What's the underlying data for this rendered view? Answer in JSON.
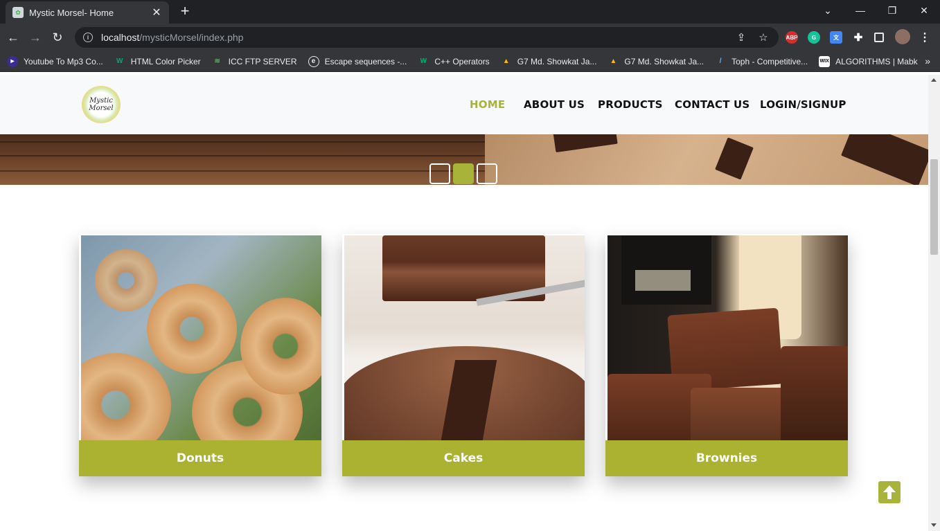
{
  "browser": {
    "tab_title": "Mystic Morsel- Home",
    "url_host": "localhost",
    "url_path": "/mysticMorsel/index.php",
    "bookmarks": [
      {
        "label": "Youtube To Mp3 Co...",
        "icon": "youtube-mp3-icon"
      },
      {
        "label": "HTML Color Picker",
        "icon": "w3schools-icon"
      },
      {
        "label": "ICC FTP SERVER",
        "icon": "icc-icon"
      },
      {
        "label": "Escape sequences -...",
        "icon": "cppreference-icon"
      },
      {
        "label": "C++ Operators",
        "icon": "w3schools-icon"
      },
      {
        "label": "G7 Md. Showkat Ja...",
        "icon": "drive-icon"
      },
      {
        "label": "G7 Md. Showkat Ja...",
        "icon": "drive-icon"
      },
      {
        "label": "Toph - Competitive...",
        "icon": "toph-icon"
      },
      {
        "label": "ALGORITHMS | Mabk",
        "icon": "wix-icon"
      }
    ],
    "extensions": [
      "ABP",
      "G"
    ]
  },
  "site": {
    "logo_text_line1": "Mystic",
    "logo_text_line2": "Morsel",
    "nav": [
      "HOME",
      "ABOUT US",
      "PRODUCTS",
      "CONTACT US",
      "LOGIN/SIGNUP"
    ],
    "active_nav": "HOME",
    "carousel": {
      "slides": 3,
      "active": 2
    },
    "cards": [
      "Donuts",
      "Cakes",
      "Brownies"
    ],
    "accent_color": "#abb232"
  }
}
